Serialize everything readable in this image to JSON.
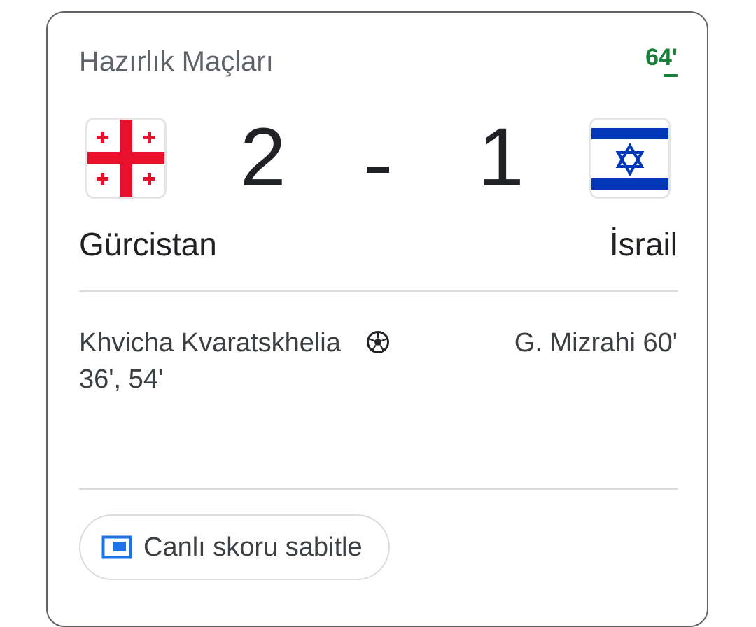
{
  "competition": {
    "title": "Hazırlık Maçları",
    "live_minute": "64'"
  },
  "home": {
    "team": "Gürcistan",
    "flag_icon": "georgia-flag-icon",
    "score": "2",
    "scorers": "Khvicha Kvaratskhelia 36', 54'"
  },
  "away": {
    "team": "İsrail",
    "flag_icon": "israel-flag-icon",
    "score": "1",
    "scorers": "G. Mizrahi 60'"
  },
  "score_separator": "-",
  "goal_icon": "soccer-ball-icon",
  "pin_button": {
    "label": "Canlı skoru sabitle",
    "icon": "picture-in-picture-icon"
  },
  "colors": {
    "live": "#188038",
    "accent_blue": "#1a73e8",
    "georgia_red": "#e8112d",
    "israel_blue": "#0038b8"
  }
}
